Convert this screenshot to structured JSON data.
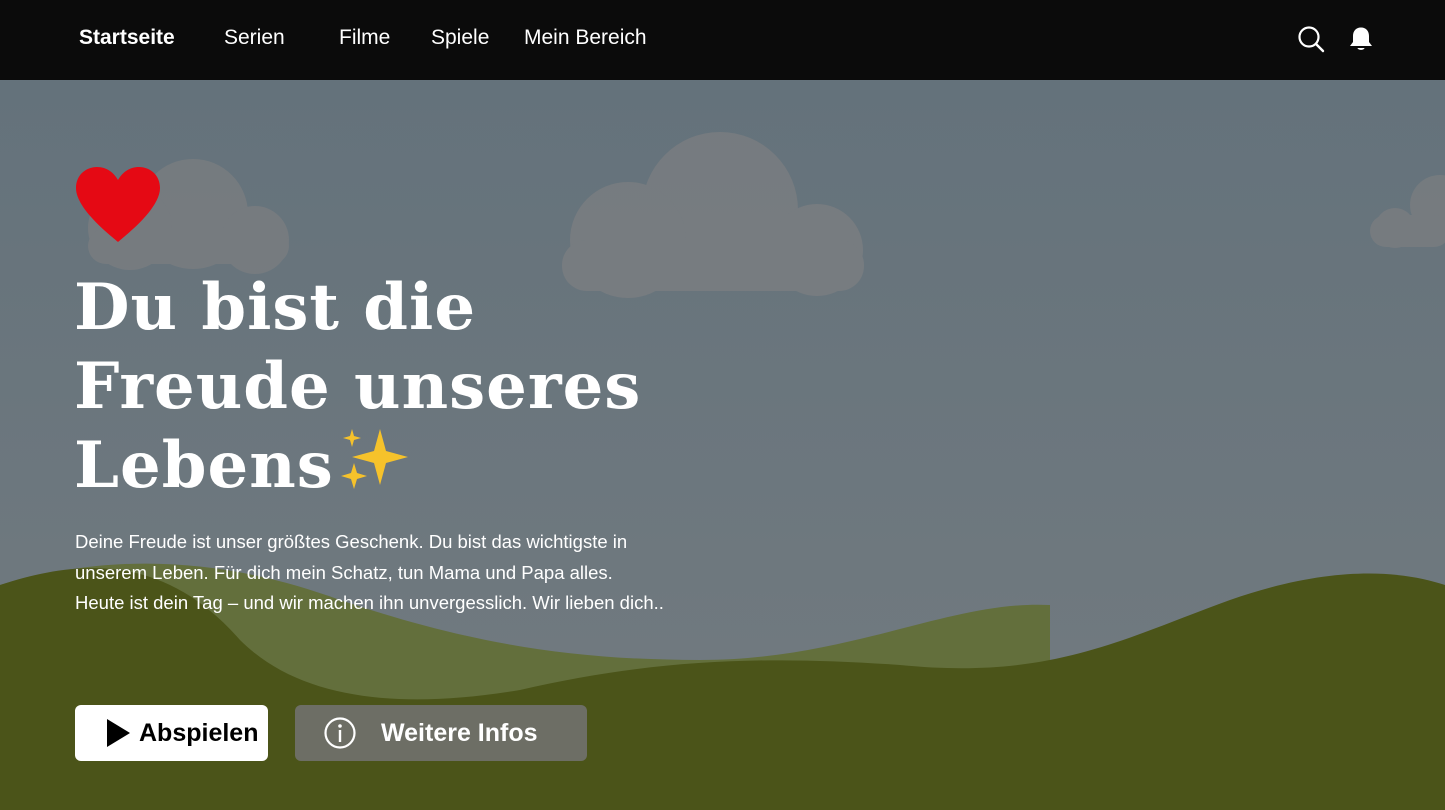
{
  "nav": {
    "items": [
      {
        "label": "Startseite",
        "active": true
      },
      {
        "label": "Serien",
        "active": false
      },
      {
        "label": "Filme",
        "active": false
      },
      {
        "label": "Spiele",
        "active": false
      },
      {
        "label": "Mein Bereich",
        "active": false
      }
    ],
    "icons": [
      "search-icon",
      "bell-icon"
    ]
  },
  "hero": {
    "badge_icon": "heart-icon",
    "title_lines": [
      "Du bist die",
      "Freude unseres",
      "Lebens"
    ],
    "title_emoji_icon": "sparkles-icon",
    "description": "Deine Freude ist unser größtes Geschenk. Du bist das wichtigste in unserem Leben. Für dich mein Schatz, tun Mama und Papa alles. Heute ist dein Tag – und wir machen ihn unvergesslich. Wir lieben dich..",
    "play_label": "Abspielen",
    "info_label": "Weitere Infos"
  },
  "colors": {
    "topbar": "#0b0b0b",
    "sky": "#69767f",
    "hills": "#4a5418",
    "heart": "#e50914",
    "sparkle": "#f6c22b"
  }
}
